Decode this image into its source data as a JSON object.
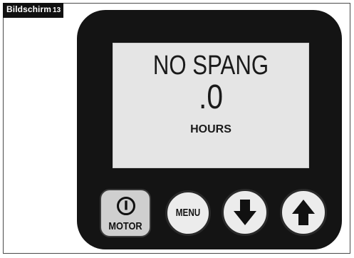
{
  "caption": {
    "label": "Bildschirm",
    "number": "13"
  },
  "display": {
    "line1": "NO SPANG",
    "line2": ".0",
    "line3": "HOURS"
  },
  "buttons": {
    "motor_label": "MOTOR",
    "menu_label": "MENU"
  },
  "icons": {
    "motor": "power-icon",
    "down": "arrow-down-icon",
    "up": "arrow-up-icon"
  },
  "colors": {
    "device_body": "#141414",
    "screen_bg": "#e5e5e5",
    "button_face": "#ececec",
    "tag_bg": "#111111"
  }
}
